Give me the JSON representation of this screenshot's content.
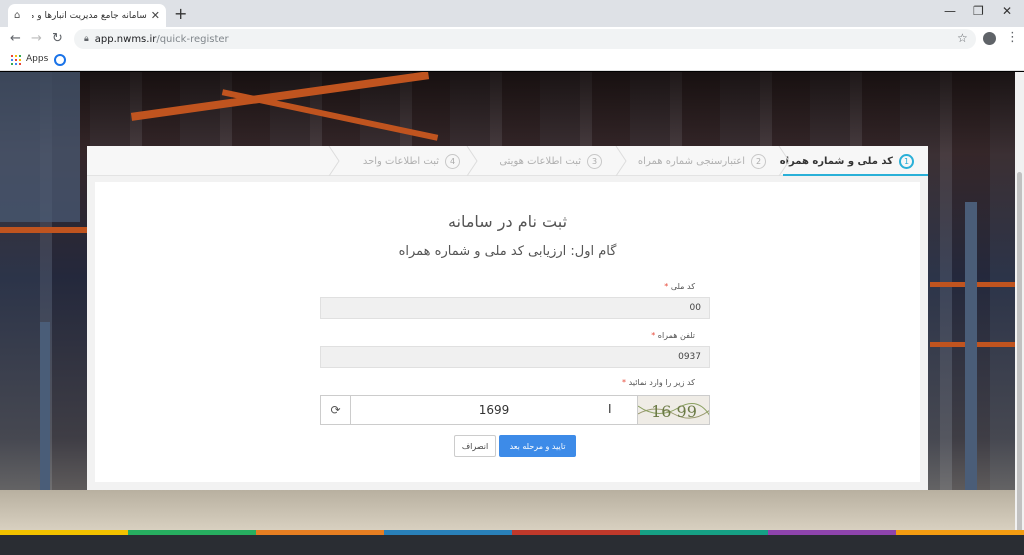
{
  "browser": {
    "tab_title": "سامانه جامع مدیریت انبارها و مراکز",
    "url_host": "app.nwms.ir",
    "url_path": "/quick-register",
    "bookmarks_apps": "Apps"
  },
  "wizard": {
    "steps": [
      {
        "num": "1",
        "label": "کد ملی و شماره همراه",
        "active": true
      },
      {
        "num": "2",
        "label": "اعتبارسنجی شماره همراه",
        "active": false
      },
      {
        "num": "3",
        "label": "ثبت اطلاعات هویتی",
        "active": false
      },
      {
        "num": "4",
        "label": "ثبت اطلاعات واحد",
        "active": false
      }
    ]
  },
  "form": {
    "title": "ثبت نام در سامانه",
    "subtitle": "گام اول: ارزیابی کد ملی و شماره همراه",
    "national_code_label": "کد ملی",
    "national_code_value": "00",
    "mobile_label": "تلفن همراه",
    "mobile_value": "0937",
    "captcha_label": "کد زیر را وارد نمائید",
    "captcha_value": "1699",
    "captcha_image_text": "16 99",
    "required_mark": "*",
    "submit_label": "تایید و مرحله بعد",
    "cancel_label": "انصراف"
  },
  "colors": {
    "accent": "#2ab0d8",
    "primary_button": "#3d8be8",
    "required": "#e74c3c"
  }
}
